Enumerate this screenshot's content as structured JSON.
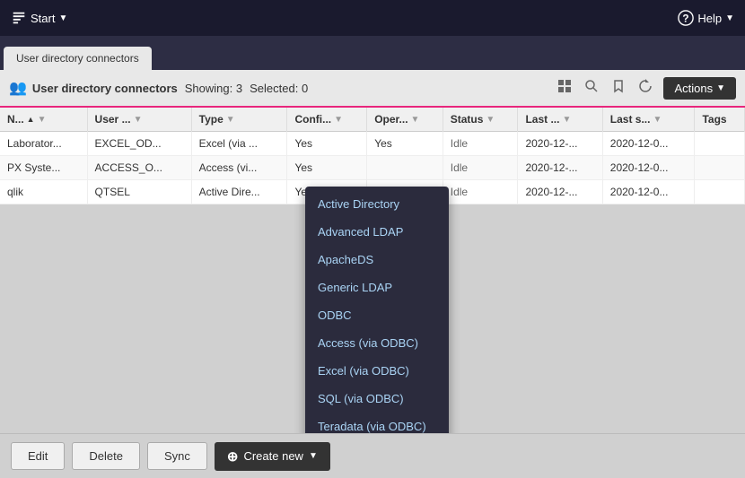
{
  "topNav": {
    "start_label": "Start",
    "help_label": "Help"
  },
  "breadcrumb": {
    "tab_label": "User directory connectors"
  },
  "toolbar": {
    "title": "User directory connectors",
    "showing_label": "Showing:",
    "showing_count": "3",
    "selected_label": "Selected:",
    "selected_count": "0",
    "actions_label": "Actions"
  },
  "table": {
    "columns": [
      {
        "label": "N...",
        "sortable": true,
        "sorted": true,
        "sortDir": "asc"
      },
      {
        "label": "User ...",
        "sortable": true
      },
      {
        "label": "Type",
        "sortable": true
      },
      {
        "label": "Confi...",
        "sortable": true
      },
      {
        "label": "Oper...",
        "sortable": true
      },
      {
        "label": "Status",
        "sortable": true
      },
      {
        "label": "Last ...",
        "sortable": true
      },
      {
        "label": "Last s...",
        "sortable": true
      },
      {
        "label": "Tags",
        "sortable": false
      }
    ],
    "rows": [
      {
        "name": "Laborator...",
        "user": "EXCEL_OD...",
        "type": "Excel (via ...",
        "config": "Yes",
        "oper": "Yes",
        "status": "Idle",
        "last1": "2020-12-...",
        "last2": "2020-12-0...",
        "tags": ""
      },
      {
        "name": "PX Syste...",
        "user": "ACCESS_O...",
        "type": "Access (vi...",
        "config": "Yes",
        "oper": "",
        "status": "Idle",
        "last1": "2020-12-...",
        "last2": "2020-12-0...",
        "tags": ""
      },
      {
        "name": "qlik",
        "user": "QTSEL",
        "type": "Active Dire...",
        "config": "Yes",
        "oper": "",
        "status": "Idle",
        "last1": "2020-12-...",
        "last2": "2020-12-0...",
        "tags": ""
      }
    ]
  },
  "dropdown": {
    "items": [
      "Active Directory",
      "Advanced LDAP",
      "ApacheDS",
      "Generic LDAP",
      "ODBC",
      "Access (via ODBC)",
      "Excel (via ODBC)",
      "SQL (via ODBC)",
      "Teradata (via ODBC)"
    ]
  },
  "bottomBar": {
    "edit_label": "Edit",
    "delete_label": "Delete",
    "sync_label": "Sync",
    "create_new_label": "Create new"
  }
}
